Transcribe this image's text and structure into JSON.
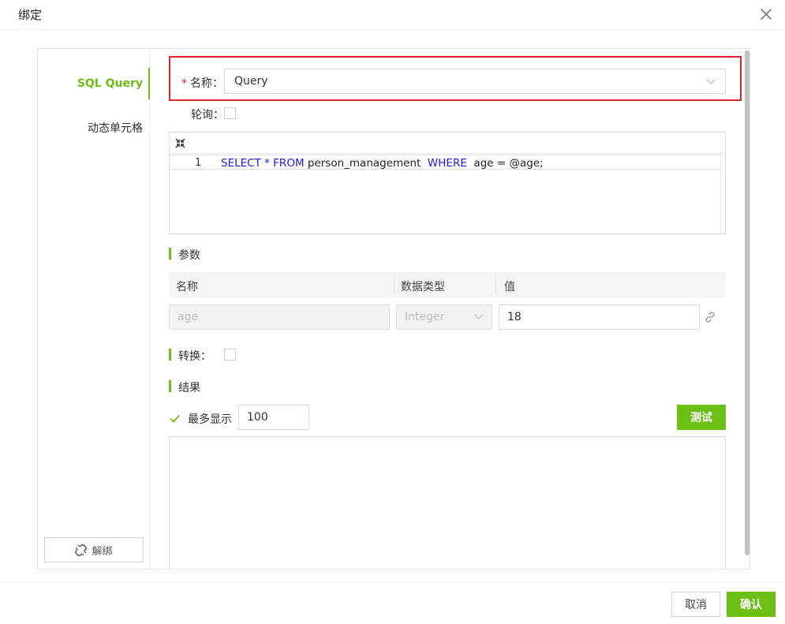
{
  "dialog": {
    "title": "绑定"
  },
  "nav": {
    "items": [
      {
        "label": "SQL Query",
        "active": true
      },
      {
        "label": "动态单元格",
        "active": false
      }
    ],
    "unbind_label": "解绑"
  },
  "form": {
    "name_label": "名称：",
    "name_required_mark": "*",
    "name_value": "Query",
    "poll_label": "轮询：",
    "poll_checked": false
  },
  "editor": {
    "line_number": "1",
    "code_tokens": [
      {
        "text": "SELECT",
        "kw": true
      },
      {
        "text": " * ",
        "kw": true
      },
      {
        "text": "FROM",
        "kw": true
      },
      {
        "text": " person_management ",
        "kw": false
      },
      {
        "text": " WHERE ",
        "kw": true
      },
      {
        "text": " age = @age;",
        "kw": false
      }
    ]
  },
  "params": {
    "section_label": "参数",
    "columns": [
      "名称",
      "数据类型",
      "值"
    ],
    "rows": [
      {
        "name": "age",
        "type": "Integer",
        "value": "18"
      }
    ]
  },
  "convert": {
    "label": "转换：",
    "checked": false
  },
  "result": {
    "section_label": "结果",
    "max_show_label": "最多显示",
    "max_show_checked": true,
    "max_show_value": "100",
    "test_label": "测试"
  },
  "footer": {
    "cancel_label": "取消",
    "confirm_label": "确认"
  },
  "colors": {
    "accent": "#6bbf15",
    "highlight": "#e0242c",
    "keyword": "#1a1aff"
  }
}
